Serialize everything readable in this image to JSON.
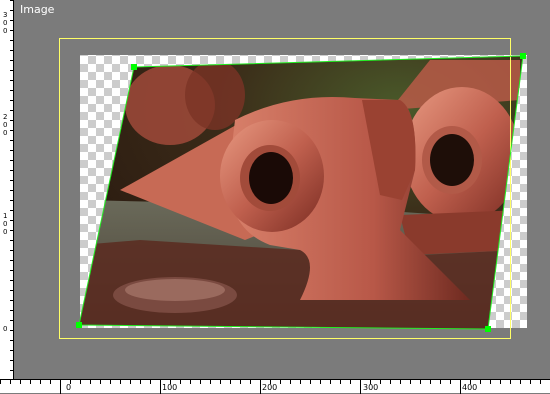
{
  "view": {
    "title": "Image"
  },
  "rulers": {
    "horizontal": [
      "0",
      "100",
      "200",
      "300",
      "400"
    ],
    "vertical": [
      "300",
      "200",
      "100",
      "0"
    ]
  },
  "colors": {
    "canvas_bg": "#7b7b7b",
    "selection_frame": "#ffff66",
    "transform_outline": "#22ee22",
    "handle": "#00ff00"
  }
}
